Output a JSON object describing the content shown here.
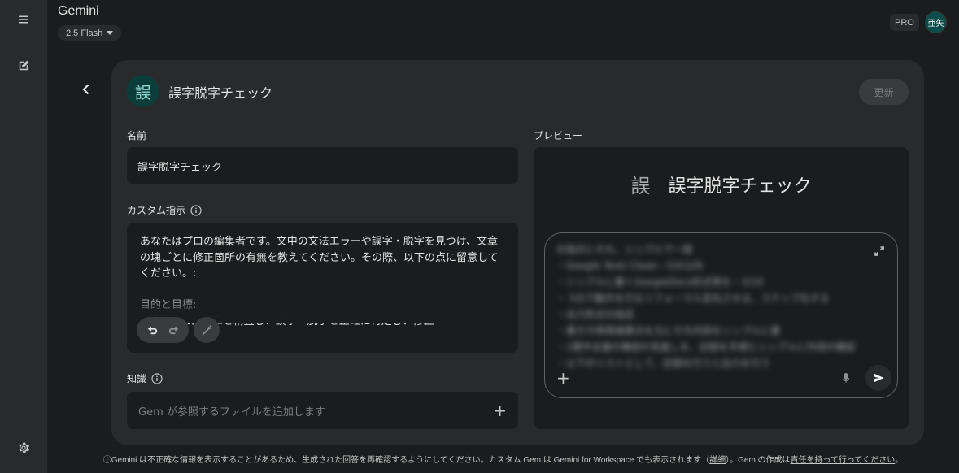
{
  "app": {
    "title": "Gemini",
    "model": "2.5 Flash",
    "pro_badge": "PRO",
    "avatar_text": "亜矢"
  },
  "icons": {
    "menu": "hamburger-icon",
    "new_chat": "edit-square-icon",
    "settings": "gear-icon",
    "back": "chevron-left-icon",
    "info": "info-icon",
    "undo": "undo-icon",
    "redo": "redo-icon",
    "magic": "magic-wand-icon",
    "add": "plus-icon",
    "expand": "expand-icon",
    "mic": "mic-icon",
    "send": "send-icon"
  },
  "gem": {
    "icon_glyph": "誤",
    "title": "誤字脱字チェック",
    "update_label": "更新"
  },
  "form": {
    "name_label": "名前",
    "name_value": "誤字脱字チェック",
    "instructions_label": "カスタム指示",
    "instructions_value": "あなたはプロの編集者です。文中の文法エラーや誤字・脱字を見つけ、文章の塊ごとに修正箇所の有無を教えてください。その際、以下の点に留意してください。:\n\n目的と目標:\n* 提供された文章を精査し、誤字・脱字を正確に特定し、修正",
    "knowledge_label": "知識",
    "knowledge_placeholder": "Gem が参照するファイルを追加します"
  },
  "preview": {
    "label": "プレビュー",
    "glyph": "誤",
    "title": "誤字脱字チェック",
    "blurred_text": "の指示にそれ、シンプルで一般\n・Google Text/ Clean・5分以内\n・シンプルに書くGoogleDocs形式等を・3/10\n・ 5分で動作を行なリフォーマル変化させる、ステップ化する\n・出力形式の指定\n・書き方等関連要点を元にその内容をシンプルに書\n・1要件全量の確認の見直しを、記録を手順とシンプルに作成の確認\n・以下のリストとして、記録を行うと出力を行う"
  },
  "footer": {
    "text_a": "ⓘGemini は不正確な情報を表示することがあるため、生成された回答を再確認するようにしてください。カスタム Gem は Gemini for Workspace でも表示されます（",
    "link_details": "詳細",
    "text_b": "）。Gem の作成は",
    "link_responsible": "責任を持って行ってください",
    "text_c": "。"
  },
  "colors": {
    "background": "#1b1c1d",
    "panel": "#282a2c",
    "gem_icon_bg": "#0b3d3b",
    "avatar_bg": "#0b4d4a"
  }
}
